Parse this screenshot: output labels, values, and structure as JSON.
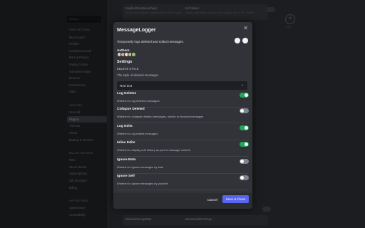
{
  "background": {
    "search_placeholder": "Search",
    "nav_items": [
      {
        "label": "User Settings",
        "header": true
      },
      {
        "label": "My Account"
      },
      {
        "label": "Profiles"
      },
      {
        "label": "Content & Social"
      },
      {
        "label": "Data & Privacy"
      },
      {
        "label": "Family Centre"
      },
      {
        "label": "Authorised Apps"
      },
      {
        "label": "Devices"
      },
      {
        "label": "Connections"
      },
      {
        "label": "Clips"
      },
      {
        "label": "",
        "spacer": true
      },
      {
        "label": "Vencord",
        "header": true
      },
      {
        "label": "Vencord"
      },
      {
        "label": "Plugins",
        "selected": true
      },
      {
        "label": "Themes"
      },
      {
        "label": "Cloud"
      },
      {
        "label": "Backup & Restore"
      },
      {
        "label": "",
        "spacer": true
      },
      {
        "label": "Billing Settings",
        "header": true
      },
      {
        "label": "Nitro"
      },
      {
        "label": "Server Boost"
      },
      {
        "label": "Subscriptions"
      },
      {
        "label": "Gift Inventory"
      },
      {
        "label": "Billing"
      },
      {
        "label": "",
        "spacer": true
      },
      {
        "label": "App Settings",
        "header": true
      },
      {
        "label": "Appearance"
      },
      {
        "label": "Accessibility"
      }
    ],
    "cards": [
      {
        "title": "ImplicitRelationships",
        "desc": "Shows your implicit relationships in the Friends tab."
      },
      {
        "title": "IrcColors",
        "desc": "Makes username colors in chat unique, like in IRC clients"
      },
      {
        "title": "MutualGroupDMs",
        "desc": ""
      },
      {
        "title": "NewGuildSettings",
        "desc": ""
      }
    ],
    "esc_label": "ESC"
  },
  "modal": {
    "title": "MessageLogger",
    "description": "Temporarily logs deleted and edited messages.",
    "authors_label": "Authors",
    "settings_label": "Settings",
    "delete_style": {
      "category": "DELETE STYLE",
      "description": "The style of deleted messages",
      "value": "Red text"
    },
    "settings": [
      {
        "label": "Log Deletes",
        "desc": "Whether to log deleted messages",
        "on": true
      },
      {
        "label": "Collapse Deleted",
        "desc": "Whether to collapse deleted messages, similar to blocked messages",
        "on": false
      },
      {
        "label": "Log Edits",
        "desc": "Whether to log edited messages",
        "on": true
      },
      {
        "label": "Inline Edits",
        "desc": "Whether to display edit history as part of message content",
        "on": true
      },
      {
        "label": "Ignore Bots",
        "desc": "Whether to ignore messages by bots",
        "on": false
      },
      {
        "label": "Ignore Self",
        "desc": "Whether to ignore messages by yourself",
        "on": false
      }
    ],
    "cancel_label": "Cancel",
    "save_label": "Save & Close"
  },
  "colors": {
    "accent": "#5865f2",
    "toggle_on": "#23a55a",
    "toggle_off": "#80848e",
    "modal_bg": "#313338"
  }
}
